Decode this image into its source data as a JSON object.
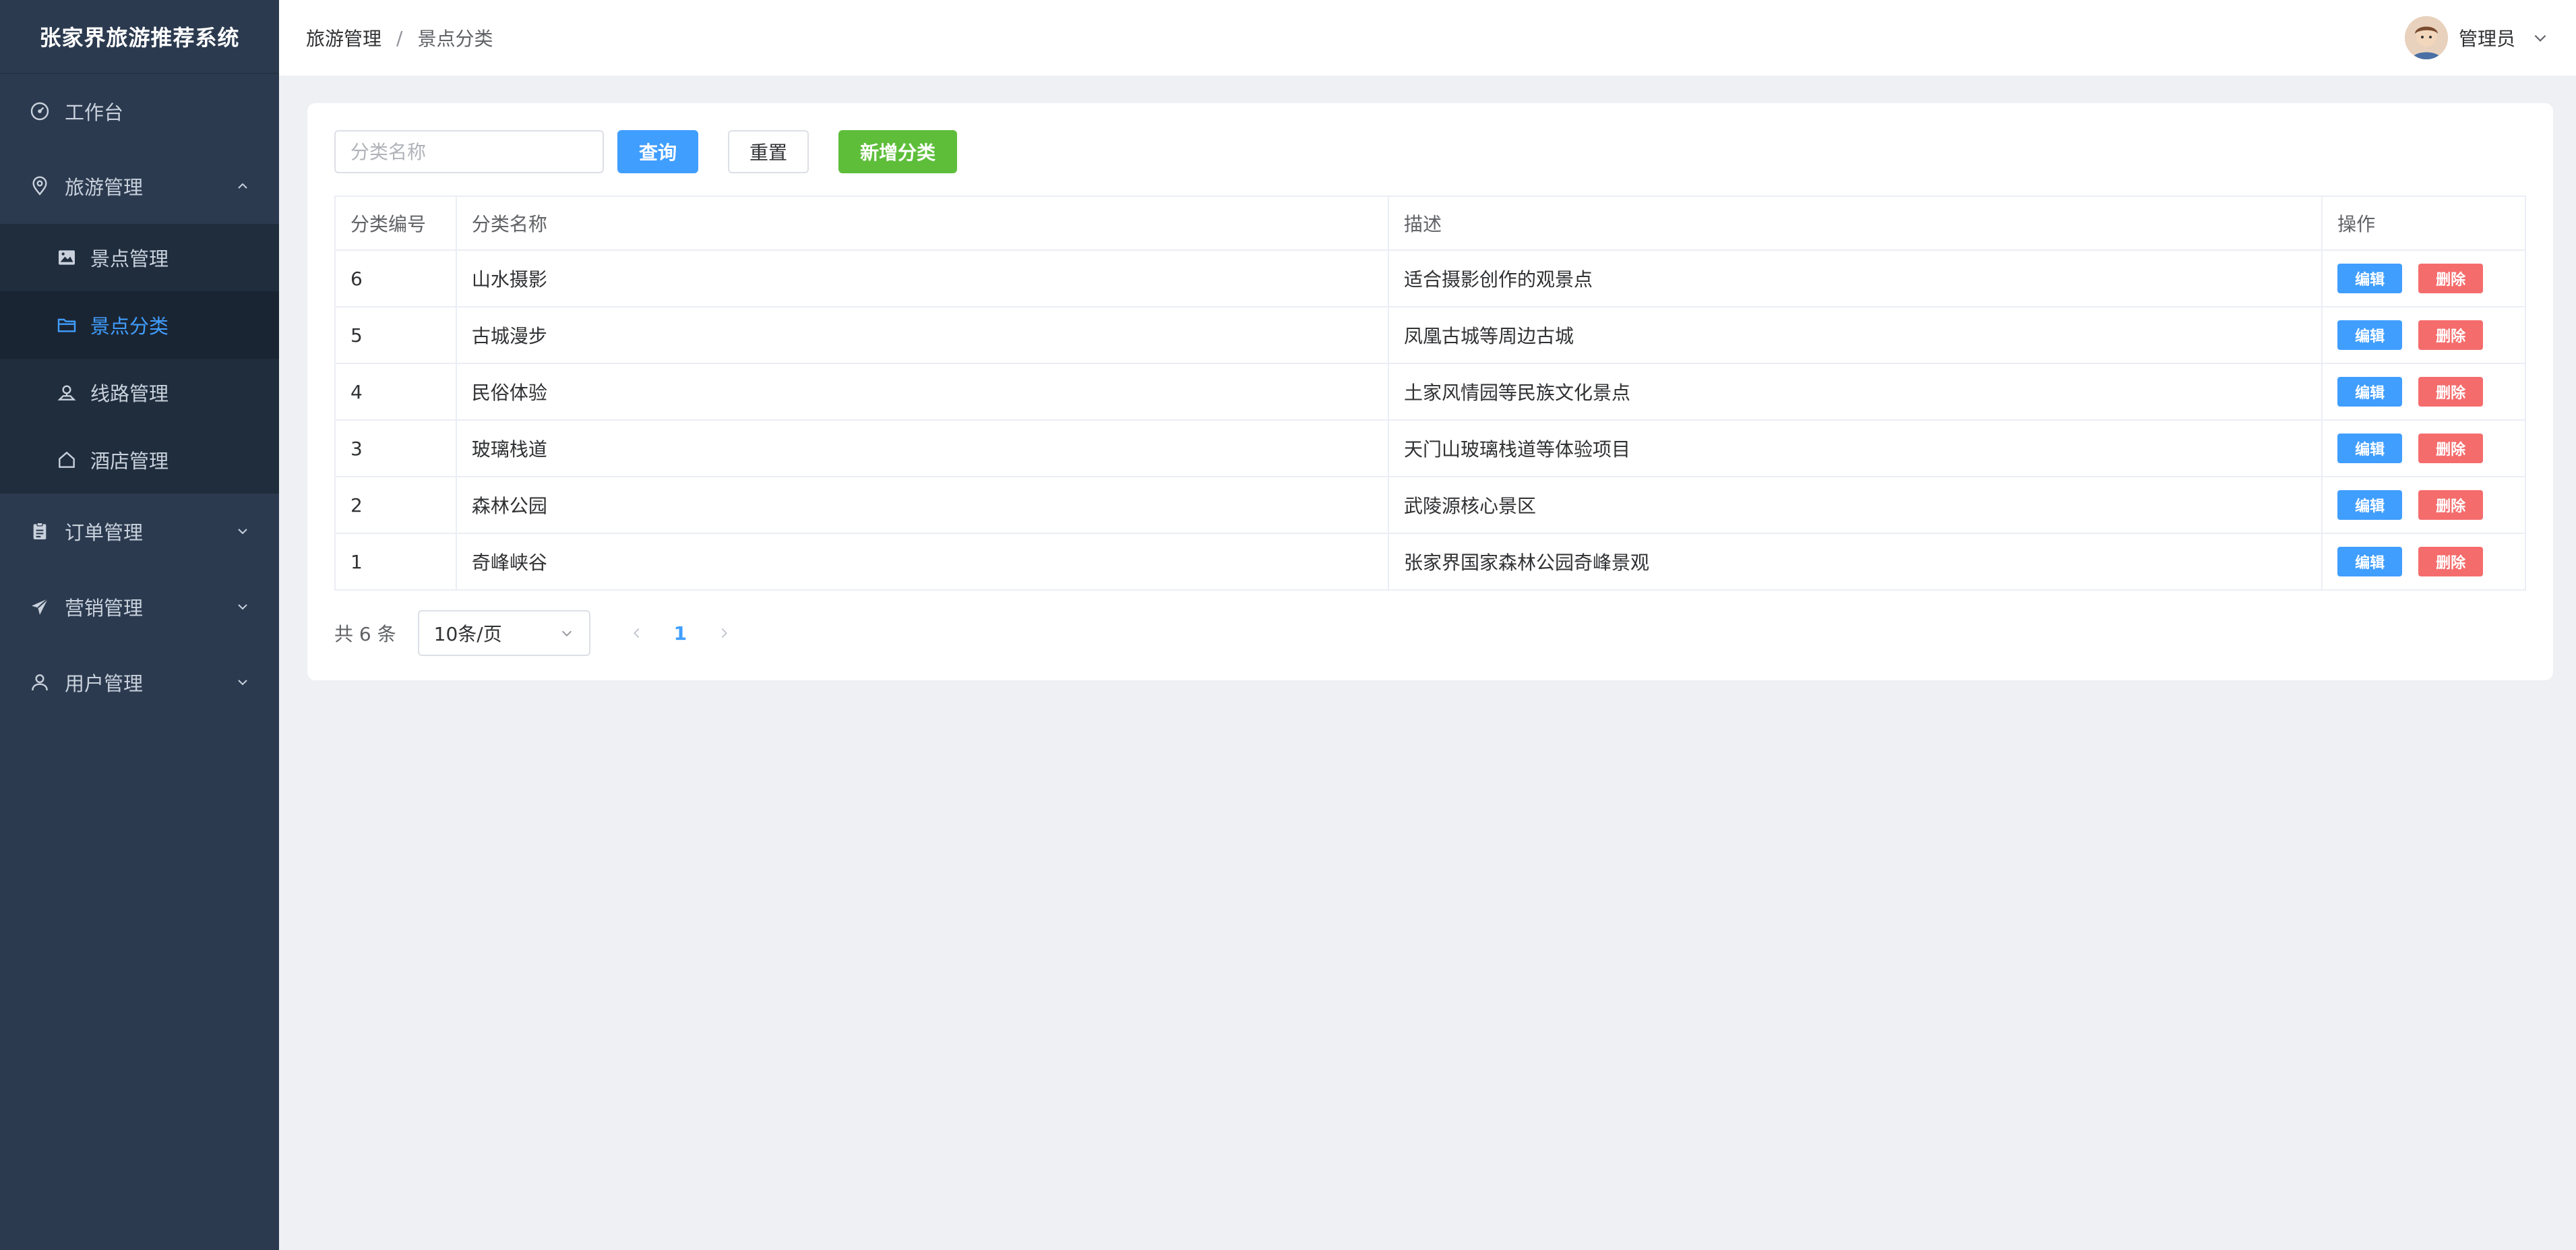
{
  "app": {
    "title": "张家界旅游推荐系统"
  },
  "colors": {
    "sidebar_bg": "#2b3a4f",
    "accent": "#409eff",
    "success": "#5ebe3a",
    "danger": "#f56c6c"
  },
  "sidebar": {
    "items": [
      {
        "label": "工作台",
        "icon": "dashboard-icon"
      },
      {
        "label": "旅游管理",
        "icon": "location-icon",
        "expanded": true,
        "children": [
          {
            "label": "景点管理",
            "icon": "image-icon"
          },
          {
            "label": "景点分类",
            "icon": "folder-icon",
            "active": true
          },
          {
            "label": "线路管理",
            "icon": "route-icon"
          },
          {
            "label": "酒店管理",
            "icon": "home-icon"
          }
        ]
      },
      {
        "label": "订单管理",
        "icon": "clipboard-icon"
      },
      {
        "label": "营销管理",
        "icon": "send-icon"
      },
      {
        "label": "用户管理",
        "icon": "user-icon"
      }
    ]
  },
  "header": {
    "breadcrumb": [
      "旅游管理",
      "景点分类"
    ],
    "separator": "/",
    "user_name": "管理员"
  },
  "toolbar": {
    "search_placeholder": "分类名称",
    "search_value": "",
    "query_label": "查询",
    "reset_label": "重置",
    "add_label": "新增分类"
  },
  "table": {
    "columns": [
      "分类编号",
      "分类名称",
      "描述",
      "操作"
    ],
    "rows": [
      {
        "id": "6",
        "name": "山水摄影",
        "desc": "适合摄影创作的观景点"
      },
      {
        "id": "5",
        "name": "古城漫步",
        "desc": "凤凰古城等周边古城"
      },
      {
        "id": "4",
        "name": "民俗体验",
        "desc": "土家风情园等民族文化景点"
      },
      {
        "id": "3",
        "name": "玻璃栈道",
        "desc": "天门山玻璃栈道等体验项目"
      },
      {
        "id": "2",
        "name": "森林公园",
        "desc": "武陵源核心景区"
      },
      {
        "id": "1",
        "name": "奇峰峡谷",
        "desc": "张家界国家森林公园奇峰景观"
      }
    ],
    "edit_label": "编辑",
    "delete_label": "删除"
  },
  "pagination": {
    "total_text": "共 6 条",
    "page_size": "10条/页",
    "current_page": "1"
  }
}
